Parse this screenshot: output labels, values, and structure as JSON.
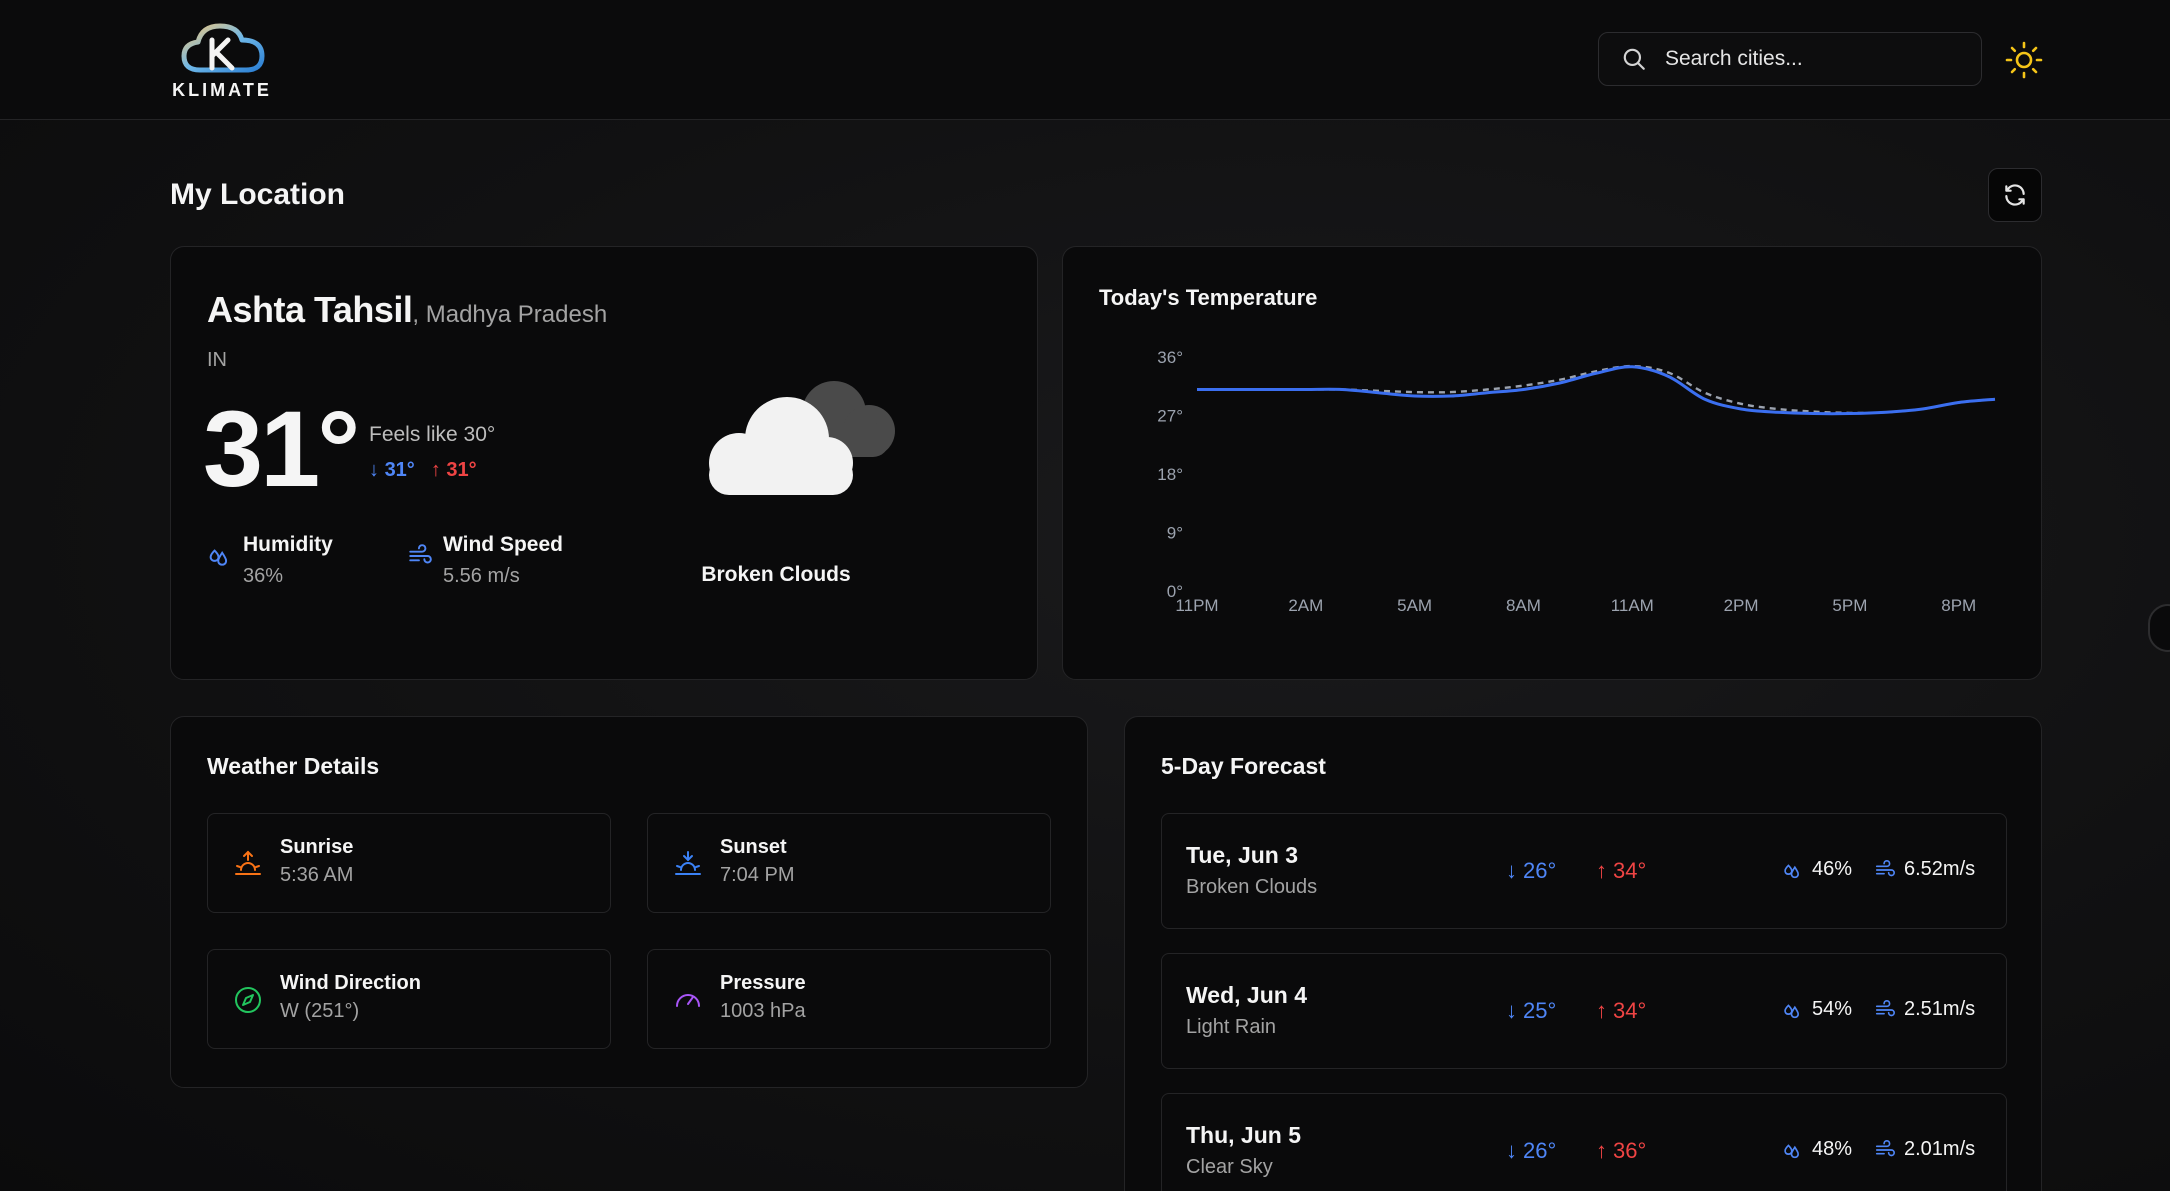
{
  "header": {
    "logo_text": "KLIMATE",
    "search_placeholder": "Search cities...",
    "theme_icon": "sun-icon",
    "accent_sun": "#f5c518"
  },
  "section": {
    "title": "My Location",
    "refresh_icon": "refresh-icon"
  },
  "current": {
    "city": "Ashta Tahsil",
    "region": ", Madhya Pradesh",
    "country": "IN",
    "temperature": "31°",
    "feels_like": "Feels like 30°",
    "min": "31°",
    "max": "31°",
    "humidity_label": "Humidity",
    "humidity_value": "36%",
    "wind_label": "Wind Speed",
    "wind_value": "5.56 m/s",
    "condition": "Broken Clouds",
    "colors": {
      "min": "#4f86f7",
      "max": "#ef4444"
    }
  },
  "chart": {
    "title": "Today's Temperature"
  },
  "chart_data": {
    "type": "line",
    "x": [
      "11PM",
      "12AM",
      "1AM",
      "2AM",
      "3AM",
      "4AM",
      "5AM",
      "6AM",
      "7AM",
      "8AM",
      "9AM",
      "10AM",
      "11AM",
      "12PM",
      "1PM",
      "2PM",
      "3PM",
      "4PM",
      "5PM",
      "6PM",
      "7PM",
      "8PM",
      "9PM"
    ],
    "tick_labels": [
      "11PM",
      "2AM",
      "5AM",
      "8AM",
      "11AM",
      "2PM",
      "5PM",
      "8PM"
    ],
    "series": [
      {
        "values": [
          31,
          31,
          31,
          31,
          31,
          30.5,
          30,
          30,
          30.5,
          31,
          32,
          33.5,
          34.5,
          33,
          29.5,
          28,
          27.5,
          27.3,
          27.3,
          27.5,
          28,
          29,
          29.5
        ],
        "color": "#3b6ff0",
        "style": "solid"
      },
      {
        "values": [
          31,
          31,
          31,
          31,
          31,
          30.8,
          30.6,
          30.6,
          31,
          31.6,
          32.5,
          33.8,
          34.6,
          33.6,
          30.5,
          28.8,
          28,
          27.6,
          27.4,
          27.5,
          28,
          29,
          29.5
        ],
        "color": "#9ca3af",
        "style": "dashed"
      }
    ],
    "yticks": [
      "0°",
      "9°",
      "18°",
      "27°",
      "36°"
    ],
    "ylim": [
      0,
      36
    ],
    "grid": false
  },
  "details": {
    "title": "Weather Details",
    "sunrise_label": "Sunrise",
    "sunrise_value": "5:36 AM",
    "sunset_label": "Sunset",
    "sunset_value": "7:04 PM",
    "wind_dir_label": "Wind Direction",
    "wind_dir_value": "W (251°)",
    "pressure_label": "Pressure",
    "pressure_value": "1003 hPa",
    "colors": {
      "sunrise": "#f97316",
      "sunset": "#3b82f6",
      "wind": "#22c55e",
      "pressure": "#a855f7"
    }
  },
  "forecast": {
    "title": "5-Day Forecast",
    "days": [
      {
        "date": "Tue, Jun 3",
        "condition": "Broken Clouds",
        "min": "26°",
        "max": "34°",
        "humidity": "46%",
        "wind": "6.52m/s"
      },
      {
        "date": "Wed, Jun 4",
        "condition": "Light Rain",
        "min": "25°",
        "max": "34°",
        "humidity": "54%",
        "wind": "2.51m/s"
      },
      {
        "date": "Thu, Jun 5",
        "condition": "Clear Sky",
        "min": "26°",
        "max": "36°",
        "humidity": "48%",
        "wind": "2.01m/s"
      }
    ]
  }
}
